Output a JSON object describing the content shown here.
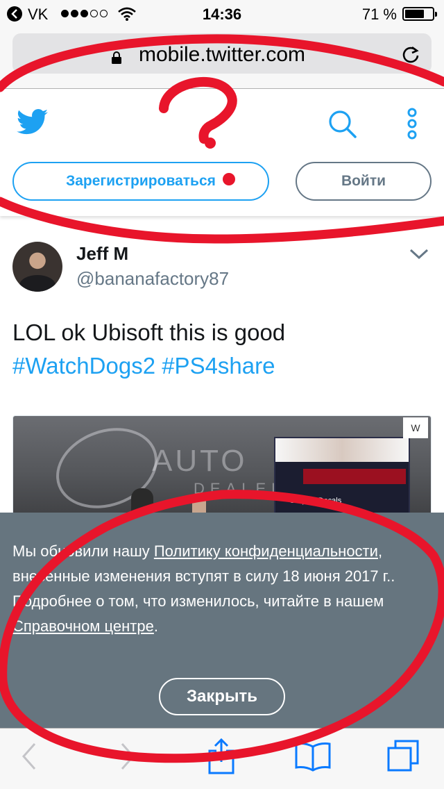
{
  "status_bar": {
    "back_app": "VK",
    "time": "14:36",
    "battery_percent": "71 %",
    "battery_level": 0.71,
    "signal_bars": 3,
    "signal_total": 5
  },
  "browser": {
    "url": "mobile.twitter.com",
    "icons": [
      "lock-icon",
      "reload-icon"
    ]
  },
  "header": {
    "logo_icon": "twitter-bird-icon",
    "search_icon": "search-icon",
    "more_icon": "more-vertical-icon",
    "signup_label": "Зарегистрироваться",
    "login_label": "Войти"
  },
  "tweet": {
    "name": "Jeff M",
    "handle": "@bananafactory87",
    "text": "LOL ok Ubisoft this is good",
    "hashtags": "#WatchDogs2 #PS4share",
    "media_text_1": "AUTO",
    "media_text_2": "DEALER",
    "media_panel_label": "Graphic Decals",
    "media_logo": "W"
  },
  "banner": {
    "text_1": "Мы обновили нашу ",
    "link_policy": "Политику конфиденциальности",
    "text_2": ", внесенные изменения вступят в силу 18 июня 2017 г.. Подробнее о том, что изменилось, читайте в нашем ",
    "link_help": "Справочном центре",
    "text_3": ".",
    "close_label": "Закрыть"
  },
  "toolbar": {
    "icons": [
      "back-icon",
      "forward-icon",
      "share-icon",
      "bookmarks-icon",
      "tabs-icon"
    ]
  },
  "colors": {
    "twitter_blue": "#1da1f2",
    "gray": "#657786",
    "banner_bg": "#66757f",
    "annotation_red": "#e8152b",
    "ios_blue": "#0a7aff"
  }
}
